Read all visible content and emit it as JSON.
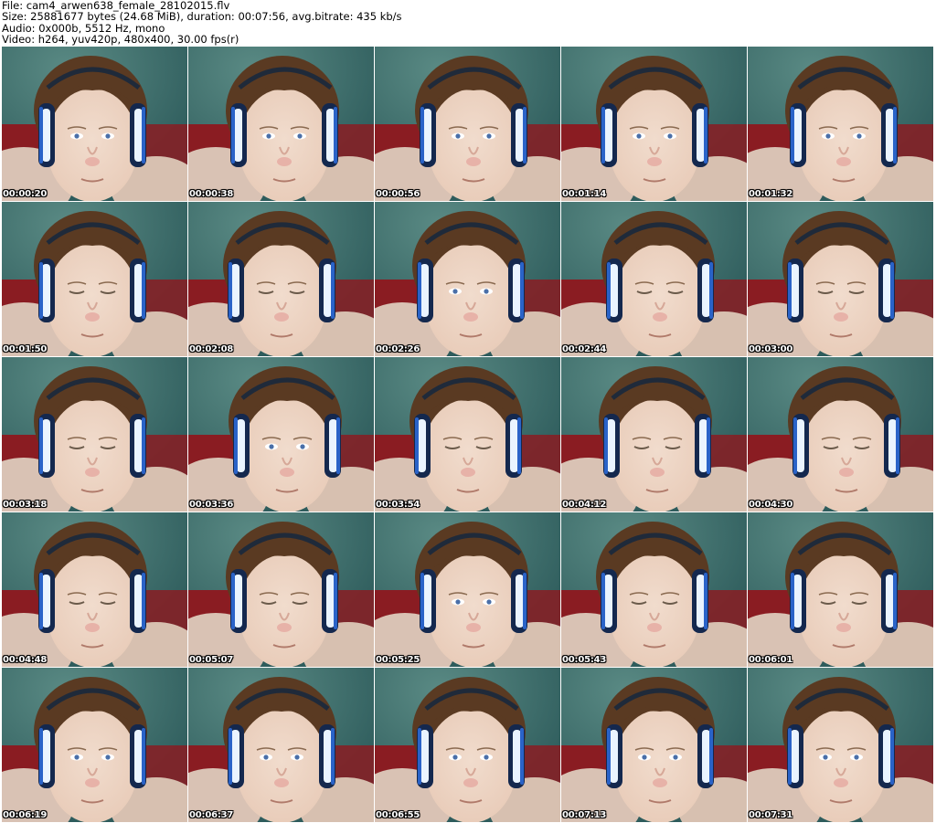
{
  "header": {
    "file_line": "File: cam4_arwen638_female_28102015.flv",
    "size_line": "Size: 25881677 bytes (24.68 MiB), duration: 00:07:56, avg.bitrate: 435 kb/s",
    "audio_line": "Audio: 0x000b, 5512 Hz, mono",
    "video_line": "Video: h264, yuv420p, 480x400, 30.00 fps(r)"
  },
  "thumbnails": [
    {
      "timestamp": "00:00:20",
      "eyes": "open"
    },
    {
      "timestamp": "00:00:38",
      "eyes": "open"
    },
    {
      "timestamp": "00:00:56",
      "eyes": "open"
    },
    {
      "timestamp": "00:01:14",
      "eyes": "open"
    },
    {
      "timestamp": "00:01:32",
      "eyes": "open"
    },
    {
      "timestamp": "00:01:50",
      "eyes": "closed"
    },
    {
      "timestamp": "00:02:08",
      "eyes": "closed"
    },
    {
      "timestamp": "00:02:26",
      "eyes": "open"
    },
    {
      "timestamp": "00:02:44",
      "eyes": "closed"
    },
    {
      "timestamp": "00:03:00",
      "eyes": "closed"
    },
    {
      "timestamp": "00:03:18",
      "eyes": "closed"
    },
    {
      "timestamp": "00:03:36",
      "eyes": "open"
    },
    {
      "timestamp": "00:03:54",
      "eyes": "closed"
    },
    {
      "timestamp": "00:04:12",
      "eyes": "closed"
    },
    {
      "timestamp": "00:04:30",
      "eyes": "closed"
    },
    {
      "timestamp": "00:04:48",
      "eyes": "closed"
    },
    {
      "timestamp": "00:05:07",
      "eyes": "closed"
    },
    {
      "timestamp": "00:05:25",
      "eyes": "open"
    },
    {
      "timestamp": "00:05:43",
      "eyes": "closed"
    },
    {
      "timestamp": "00:06:01",
      "eyes": "closed"
    },
    {
      "timestamp": "00:06:19",
      "eyes": "open"
    },
    {
      "timestamp": "00:06:37",
      "eyes": "open"
    },
    {
      "timestamp": "00:06:55",
      "eyes": "open"
    },
    {
      "timestamp": "00:07:13",
      "eyes": "open"
    },
    {
      "timestamp": "00:07:31",
      "eyes": "open"
    }
  ],
  "colors": {
    "background_wall": "#2e5c5c",
    "wall_highlight": "#5a8a84",
    "red_bed": "#8a1c22",
    "skin": "#e8cbb8",
    "hair": "#5a3a22",
    "headphone_glow": "#eaf4ff",
    "headphone_edge": "#2a63c8",
    "timestamp_text": "#ffffff"
  }
}
